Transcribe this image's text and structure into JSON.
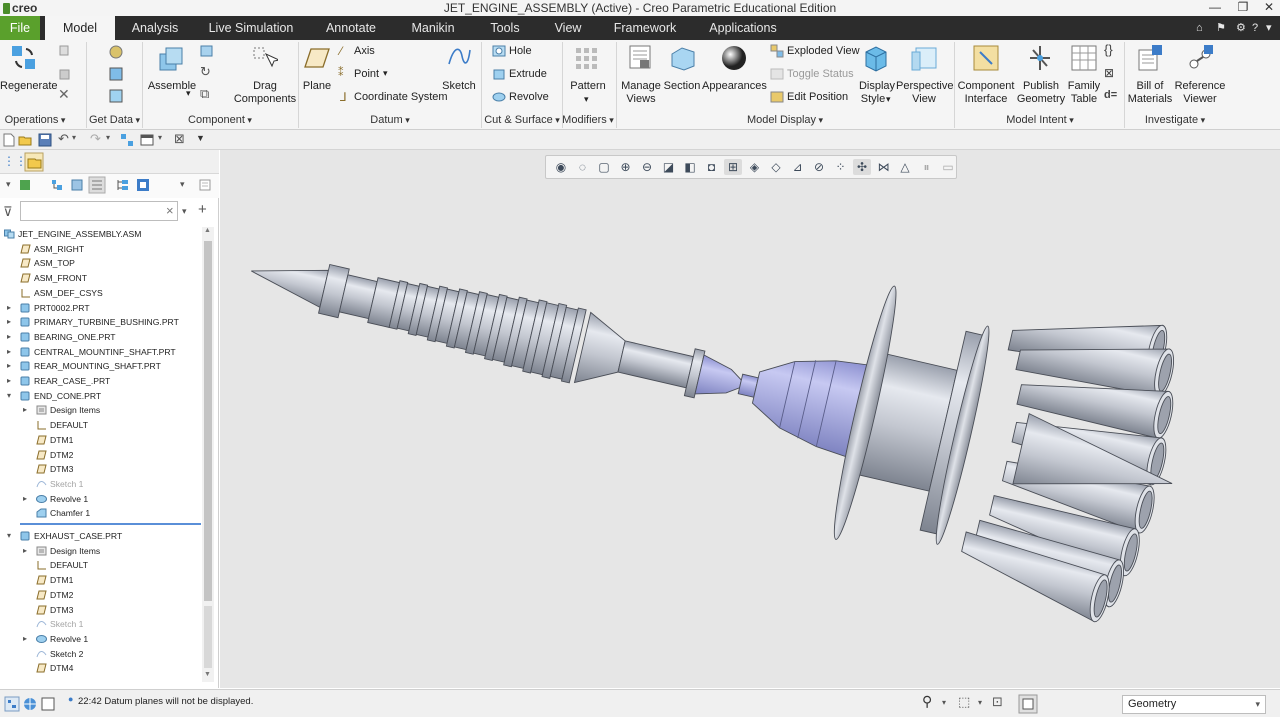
{
  "window": {
    "logo_text": "creo",
    "title": "JET_ENGINE_ASSEMBLY (Active) - Creo Parametric Educational Edition",
    "min_glyph": "—",
    "restore_glyph": "❐",
    "close_glyph": "✕"
  },
  "tabs": [
    "File",
    "Model",
    "Analysis",
    "Live Simulation",
    "Annotate",
    "Manikin",
    "Tools",
    "View",
    "Framework",
    "Applications"
  ],
  "ribbon": {
    "operations": {
      "regenerate": "Regenerate",
      "group": "Operations"
    },
    "get_data": {
      "group": "Get Data"
    },
    "component": {
      "assemble": "Assemble",
      "drag1": "Drag",
      "drag2": "Components",
      "group": "Component"
    },
    "datum": {
      "plane": "Plane",
      "axis": "Axis",
      "point": "Point",
      "csys": "Coordinate System",
      "sketch": "Sketch",
      "group": "Datum"
    },
    "cut_surface": {
      "hole": "Hole",
      "extrude": "Extrude",
      "revolve": "Revolve",
      "group": "Cut & Surface"
    },
    "modifiers": {
      "pattern": "Pattern",
      "group": "Modifiers"
    },
    "model_display": {
      "manage1": "Manage",
      "manage2": "Views",
      "section": "Section",
      "appearances": "Appearances",
      "exploded": "Exploded View",
      "toggle": "Toggle Status",
      "edit_pos": "Edit Position",
      "display1": "Display",
      "display2": "Style",
      "persp1": "Perspective",
      "persp2": "View",
      "group": "Model Display"
    },
    "model_intent": {
      "comp1": "Component",
      "comp2": "Interface",
      "pub1": "Publish",
      "pub2": "Geometry",
      "fam1": "Family",
      "fam2": "Table",
      "dequals": "d=",
      "group": "Model Intent"
    },
    "investigate": {
      "bom1": "Bill of",
      "bom2": "Materials",
      "ref1": "Reference",
      "ref2": "Viewer",
      "group": "Investigate"
    }
  },
  "filter": {
    "placeholder": "",
    "clear_glyph": "×"
  },
  "tree": [
    {
      "label": "JET_ENGINE_ASSEMBLY.ASM",
      "icon": "assembly-icon",
      "level": 0,
      "expander": "",
      "disabled": false
    },
    {
      "label": "ASM_RIGHT",
      "icon": "datum-plane-icon",
      "level": 1,
      "expander": "",
      "disabled": false
    },
    {
      "label": "ASM_TOP",
      "icon": "datum-plane-icon",
      "level": 1,
      "expander": "",
      "disabled": false
    },
    {
      "label": "ASM_FRONT",
      "icon": "datum-plane-icon",
      "level": 1,
      "expander": "",
      "disabled": false
    },
    {
      "label": "ASM_DEF_CSYS",
      "icon": "csys-icon",
      "level": 1,
      "expander": "",
      "disabled": false
    },
    {
      "label": "PRT0002.PRT",
      "icon": "part-icon",
      "level": 1,
      "expander": "▸",
      "disabled": false
    },
    {
      "label": "PRIMARY_TURBINE_BUSHING.PRT",
      "icon": "part-icon",
      "level": 1,
      "expander": "▸",
      "disabled": false
    },
    {
      "label": "BEARING_ONE.PRT",
      "icon": "part-icon",
      "level": 1,
      "expander": "▸",
      "disabled": false
    },
    {
      "label": "CENTRAL_MOUNTINF_SHAFT.PRT",
      "icon": "part-icon",
      "level": 1,
      "expander": "▸",
      "disabled": false
    },
    {
      "label": "REAR_MOUNTING_SHAFT.PRT",
      "icon": "part-icon",
      "level": 1,
      "expander": "▸",
      "disabled": false
    },
    {
      "label": "REAR_CASE_.PRT",
      "icon": "part-icon",
      "level": 1,
      "expander": "▸",
      "disabled": false
    },
    {
      "label": "END_CONE.PRT",
      "icon": "part-icon",
      "level": 1,
      "expander": "▾",
      "disabled": false
    },
    {
      "label": "Design Items",
      "icon": "design-items-icon",
      "level": 2,
      "expander": "▸",
      "disabled": false
    },
    {
      "label": "DEFAULT",
      "icon": "csys-icon",
      "level": 2,
      "expander": "",
      "disabled": false
    },
    {
      "label": "DTM1",
      "icon": "datum-plane-icon",
      "level": 2,
      "expander": "",
      "disabled": false
    },
    {
      "label": "DTM2",
      "icon": "datum-plane-icon",
      "level": 2,
      "expander": "",
      "disabled": false
    },
    {
      "label": "DTM3",
      "icon": "datum-plane-icon",
      "level": 2,
      "expander": "",
      "disabled": false
    },
    {
      "label": "Sketch 1",
      "icon": "sketch-icon",
      "level": 2,
      "expander": "",
      "disabled": true
    },
    {
      "label": "Revolve 1",
      "icon": "revolve-icon",
      "level": 2,
      "expander": "▸",
      "disabled": false
    },
    {
      "label": "Chamfer 1",
      "icon": "chamfer-icon",
      "level": 2,
      "expander": "",
      "disabled": false
    },
    {
      "label": "EXHAUST_CASE.PRT",
      "icon": "part-icon",
      "level": 1,
      "expander": "▾",
      "disabled": false
    },
    {
      "label": "Design Items",
      "icon": "design-items-icon",
      "level": 2,
      "expander": "▸",
      "disabled": false
    },
    {
      "label": "DEFAULT",
      "icon": "csys-icon",
      "level": 2,
      "expander": "",
      "disabled": false
    },
    {
      "label": "DTM1",
      "icon": "datum-plane-icon",
      "level": 2,
      "expander": "",
      "disabled": false
    },
    {
      "label": "DTM2",
      "icon": "datum-plane-icon",
      "level": 2,
      "expander": "",
      "disabled": false
    },
    {
      "label": "DTM3",
      "icon": "datum-plane-icon",
      "level": 2,
      "expander": "",
      "disabled": false
    },
    {
      "label": "Sketch 1",
      "icon": "sketch-icon",
      "level": 2,
      "expander": "",
      "disabled": true
    },
    {
      "label": "Revolve 1",
      "icon": "revolve-icon",
      "level": 2,
      "expander": "▸",
      "disabled": false
    },
    {
      "label": "Sketch 2",
      "icon": "sketch-icon",
      "level": 2,
      "expander": "",
      "disabled": false
    },
    {
      "label": "DTM4",
      "icon": "datum-plane-icon",
      "level": 2,
      "expander": "",
      "disabled": false
    }
  ],
  "status": {
    "message": "22:42 Datum planes will not be displayed.",
    "selection_filter": "Geometry"
  },
  "colors": {
    "file_tab": "#5aa02c",
    "tab_bar": "#2c2c2c",
    "canvas_bg": "#e6e6e6",
    "model_gray": "#c6cad3",
    "model_highlight": "#a9ade6"
  }
}
